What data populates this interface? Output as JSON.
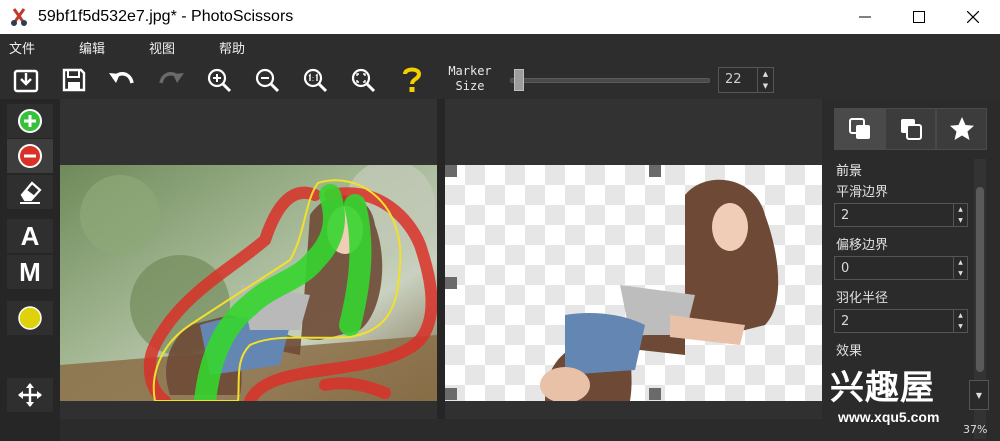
{
  "window": {
    "title": "59bf1f5d532e7.jpg* - PhotoScissors"
  },
  "menu": [
    "文件",
    "编辑",
    "视图",
    "帮助"
  ],
  "toolbar": {
    "marker_label": "Marker Size",
    "marker_size": "22",
    "marker_slider_fraction": 0.02
  },
  "left_tools": {
    "text_tool": "A",
    "manual_tool": "M"
  },
  "right_panel": {
    "section_title": "前景",
    "smooth_label": "平滑边界",
    "smooth_value": "2",
    "offset_label": "偏移边界",
    "offset_value": "0",
    "feather_label": "羽化半径",
    "feather_value": "2",
    "effect_label": "效果"
  },
  "watermark": {
    "logo": "兴趣屋",
    "url": "www.xqu5.com"
  },
  "status": {
    "zoom": "37%"
  },
  "colors": {
    "keep_marker": "#35c13a",
    "remove_marker": "#d93028",
    "help_icon": "#f5d000",
    "color_swatch": "#e0d20a"
  }
}
